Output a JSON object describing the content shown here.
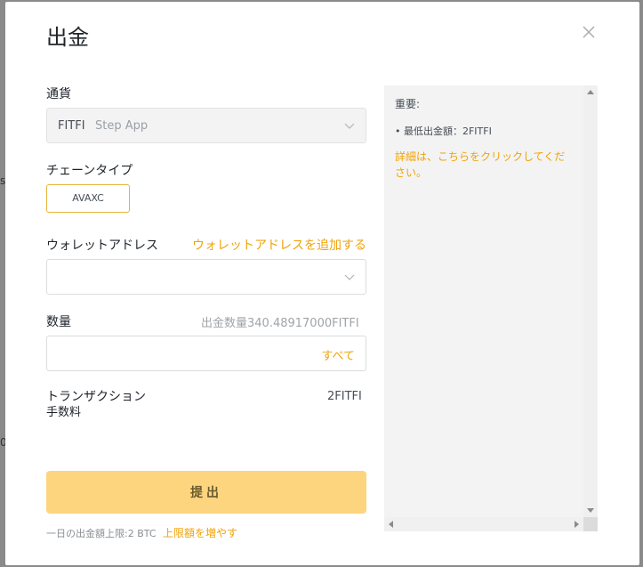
{
  "modal": {
    "title": "出金",
    "close_icon": "close-icon"
  },
  "currency": {
    "label": "通貨",
    "code": "FITFI",
    "name": "Step App"
  },
  "chain": {
    "label": "チェーンタイプ",
    "selected": "AVAXC"
  },
  "wallet": {
    "label": "ウォレットアドレス",
    "add_link": "ウォレットアドレスを追加する",
    "value": ""
  },
  "amount": {
    "label": "数量",
    "available": "出金数量340.48917000FITFI",
    "value": "",
    "all_link": "すべて"
  },
  "fee": {
    "label_line1": "トランザクション",
    "label_line2": "手数料",
    "value": "2FITFI"
  },
  "submit": {
    "label": "提出"
  },
  "footer": {
    "limit_text": "一日の出金額上限:2 BTC",
    "increase_link": "上限額を増やす"
  },
  "side_panel": {
    "title": "重要:",
    "min_amount": "• 最低出金額：2FITFI",
    "details_link": "詳細は、こちらをクリックしてください。"
  },
  "colors": {
    "accent": "#f0a30a",
    "button_bg": "#fdd57e",
    "chain_border": "#e8b43c"
  }
}
